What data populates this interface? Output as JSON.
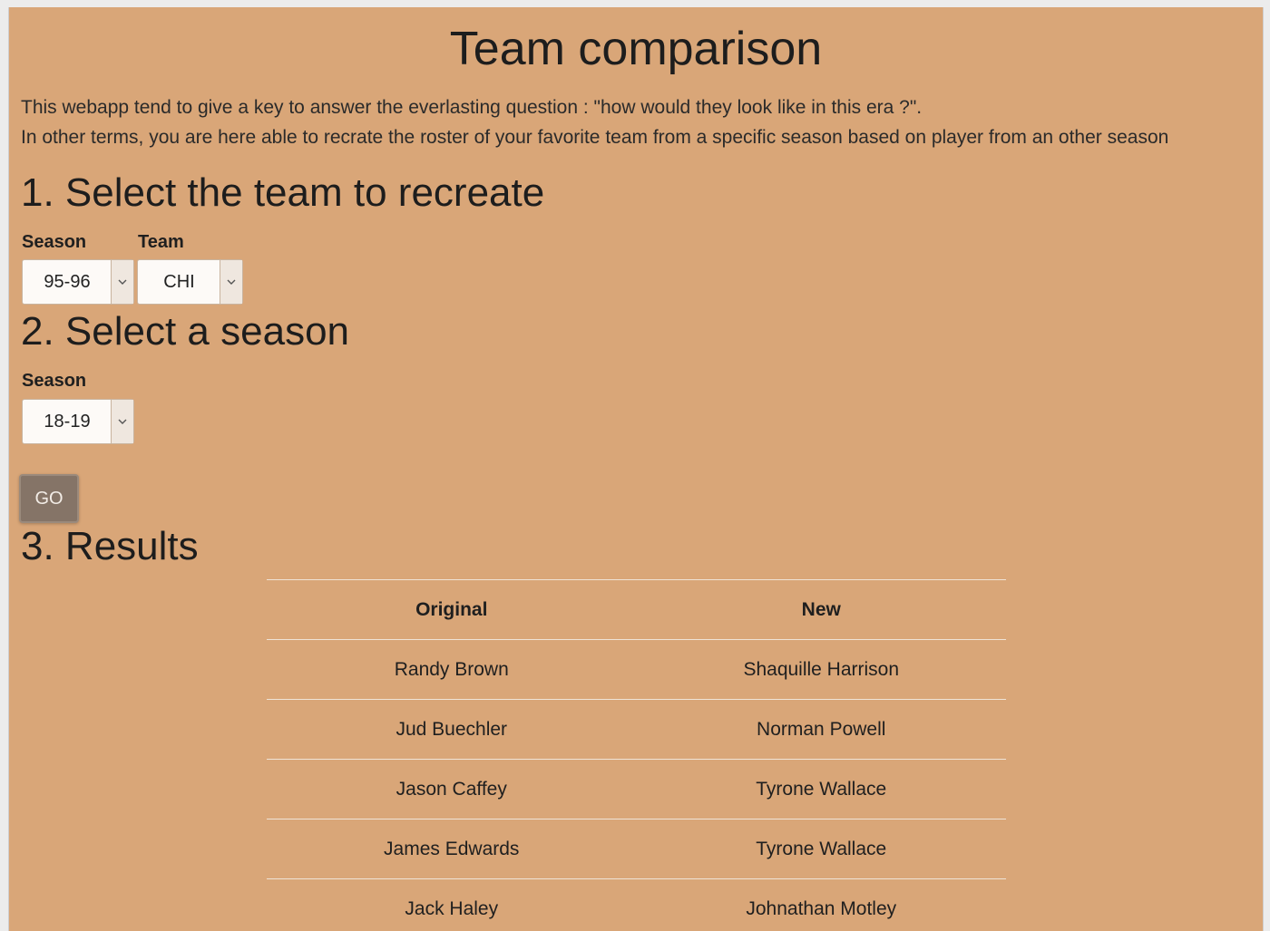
{
  "title": "Team comparison",
  "intro": {
    "line1": "This webapp tend to give a key to answer the everlasting question : \"how would they look like in this era ?\".",
    "line2": "In other terms, you are here able to recrate the roster of your favorite team from a specific season based on player from an other season"
  },
  "section1": {
    "heading": "1. Select the team to recreate",
    "season_label": "Season",
    "season_value": "95-96",
    "team_label": "Team",
    "team_value": "CHI"
  },
  "section2": {
    "heading": "2. Select a season",
    "season_label": "Season",
    "season_value": "18-19"
  },
  "go_button": "GO",
  "section3": {
    "heading": "3. Results"
  },
  "results": {
    "columns": [
      "Original",
      "New"
    ],
    "rows": [
      [
        "Randy Brown",
        "Shaquille Harrison"
      ],
      [
        "Jud Buechler",
        "Norman Powell"
      ],
      [
        "Jason Caffey",
        "Tyrone Wallace"
      ],
      [
        "James Edwards",
        "Tyrone Wallace"
      ],
      [
        "Jack Haley",
        "Johnathan Motley"
      ]
    ]
  },
  "icons": {
    "dropdown": "chevron-down-icon"
  },
  "colors": {
    "background": "#d9a678",
    "button": "#857467"
  }
}
